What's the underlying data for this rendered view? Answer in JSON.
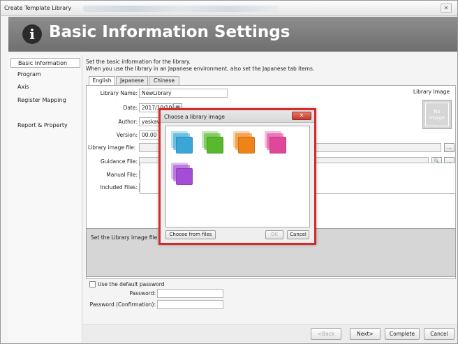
{
  "window": {
    "title": "Create Template Library",
    "close_glyph": "✕"
  },
  "header": {
    "info_glyph": "i",
    "title": "Basic Information Settings"
  },
  "sidebar": {
    "items": [
      {
        "label": "Basic Information",
        "active": true
      },
      {
        "label": "Program"
      },
      {
        "label": "Axis"
      },
      {
        "label": "Register Mapping"
      },
      {
        "label": "Report & Property"
      }
    ]
  },
  "main": {
    "desc1": "Set the basic information for the library.",
    "desc2": "When you use the library in an Japanese environment, also set the Japanese tab items.",
    "tabs": [
      "English",
      "Japanese",
      "Chinese"
    ],
    "form": {
      "library_name_label": "Library Name:",
      "library_name_value": "NewLibrary",
      "date_label": "Date:",
      "date_value": "2017/10/10",
      "author_label": "Author:",
      "author_value": "yaskaw",
      "version_label": "Version:",
      "version_value": "00.00",
      "library_image_file_label": "Library image file:",
      "guidance_file_label": "Guidance File:",
      "manual_file_label": "Manual File:",
      "included_files_label": "Included Files:",
      "browse_glyph": "...",
      "search_glyph": "🔍"
    },
    "library_image": {
      "label": "Library Image",
      "placeholder": "No Image"
    },
    "help_text": "Set the Library image file",
    "password": {
      "use_default_label": "Use the default password",
      "password_label": "Password:",
      "confirm_label": "Password (Confirmation):"
    }
  },
  "footer": {
    "back": "<Back",
    "next": "Next>",
    "complete": "Complete",
    "cancel": "Cancel"
  },
  "dialog": {
    "title": "Choose a library image",
    "close_glyph": "✕",
    "choose_from_files": "Choose from files",
    "ok": "OK",
    "cancel": "Cancel",
    "icons": [
      {
        "name": "blue-library-icon",
        "color": "#3aa6d8"
      },
      {
        "name": "green-library-icon",
        "color": "#58b82e"
      },
      {
        "name": "orange-library-icon",
        "color": "#ee8418"
      },
      {
        "name": "pink-library-icon",
        "color": "#e0479b"
      },
      {
        "name": "purple-library-icon",
        "color": "#a44ed8"
      }
    ]
  }
}
